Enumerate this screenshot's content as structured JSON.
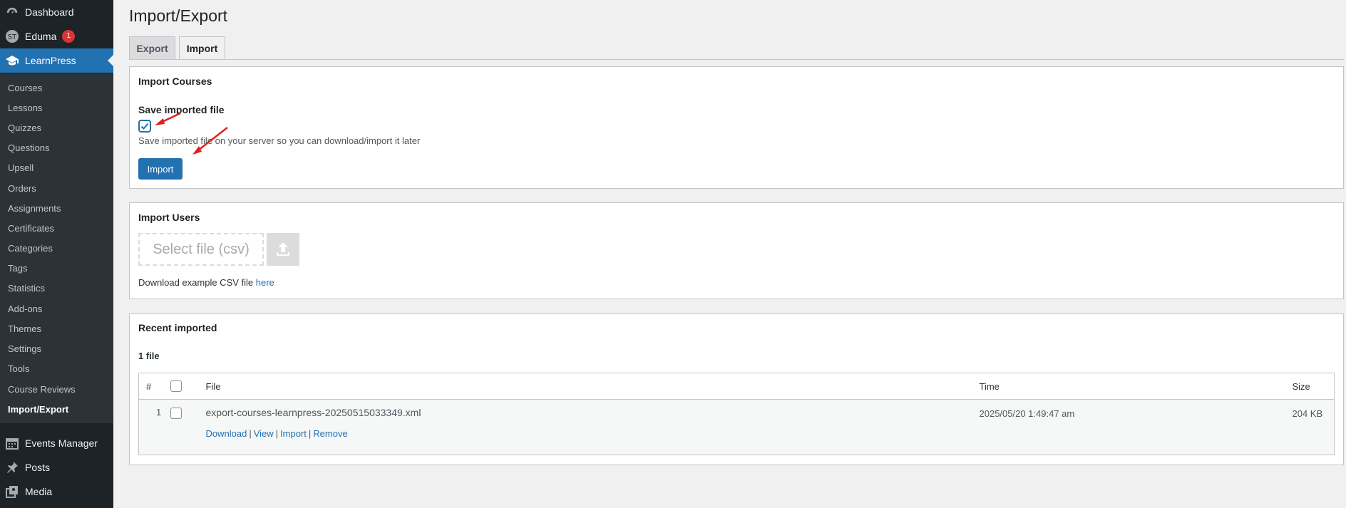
{
  "sidebar": {
    "top": [
      {
        "label": "Dashboard",
        "icon": "dashboard-icon"
      },
      {
        "label": "Eduma",
        "icon": "eduma-icon",
        "badge": "1"
      },
      {
        "label": "LearnPress",
        "icon": "graduation-cap-icon"
      }
    ],
    "submenu": [
      "Courses",
      "Lessons",
      "Quizzes",
      "Questions",
      "Upsell",
      "Orders",
      "Assignments",
      "Certificates",
      "Categories",
      "Tags",
      "Statistics",
      "Add-ons",
      "Themes",
      "Settings",
      "Tools",
      "Course Reviews",
      "Import/Export"
    ],
    "bottom": [
      {
        "label": "Events Manager",
        "icon": "calendar-icon"
      },
      {
        "label": "Posts",
        "icon": "pushpin-icon"
      },
      {
        "label": "Media",
        "icon": "media-icon"
      }
    ]
  },
  "page": {
    "title": "Import/Export",
    "tabs": [
      "Export",
      "Import"
    ],
    "active_tab": "Import"
  },
  "import_courses": {
    "title": "Import Courses",
    "save_label": "Save imported file",
    "save_checked": true,
    "save_desc": "Save imported file on your server so you can download/import it later",
    "import_button": "Import"
  },
  "import_users": {
    "title": "Import Users",
    "select_file": "Select file (csv)",
    "download_text": "Download example CSV file",
    "download_link": "here"
  },
  "recent": {
    "title": "Recent imported",
    "count": "1 file",
    "columns": [
      "#",
      "File",
      "Time",
      "Size"
    ],
    "rows": [
      {
        "num": "1",
        "file": "export-courses-learnpress-20250515033349.xml",
        "time": "2025/05/20 1:49:47 am",
        "size": "204 KB",
        "actions": [
          "Download",
          "View",
          "Import",
          "Remove"
        ]
      }
    ]
  },
  "colors": {
    "sidebar_bg": "#1d2327",
    "submenu_bg": "#2c3338",
    "accent": "#2271b1",
    "badge": "#d63638",
    "annotation_arrow": "#e02020"
  }
}
